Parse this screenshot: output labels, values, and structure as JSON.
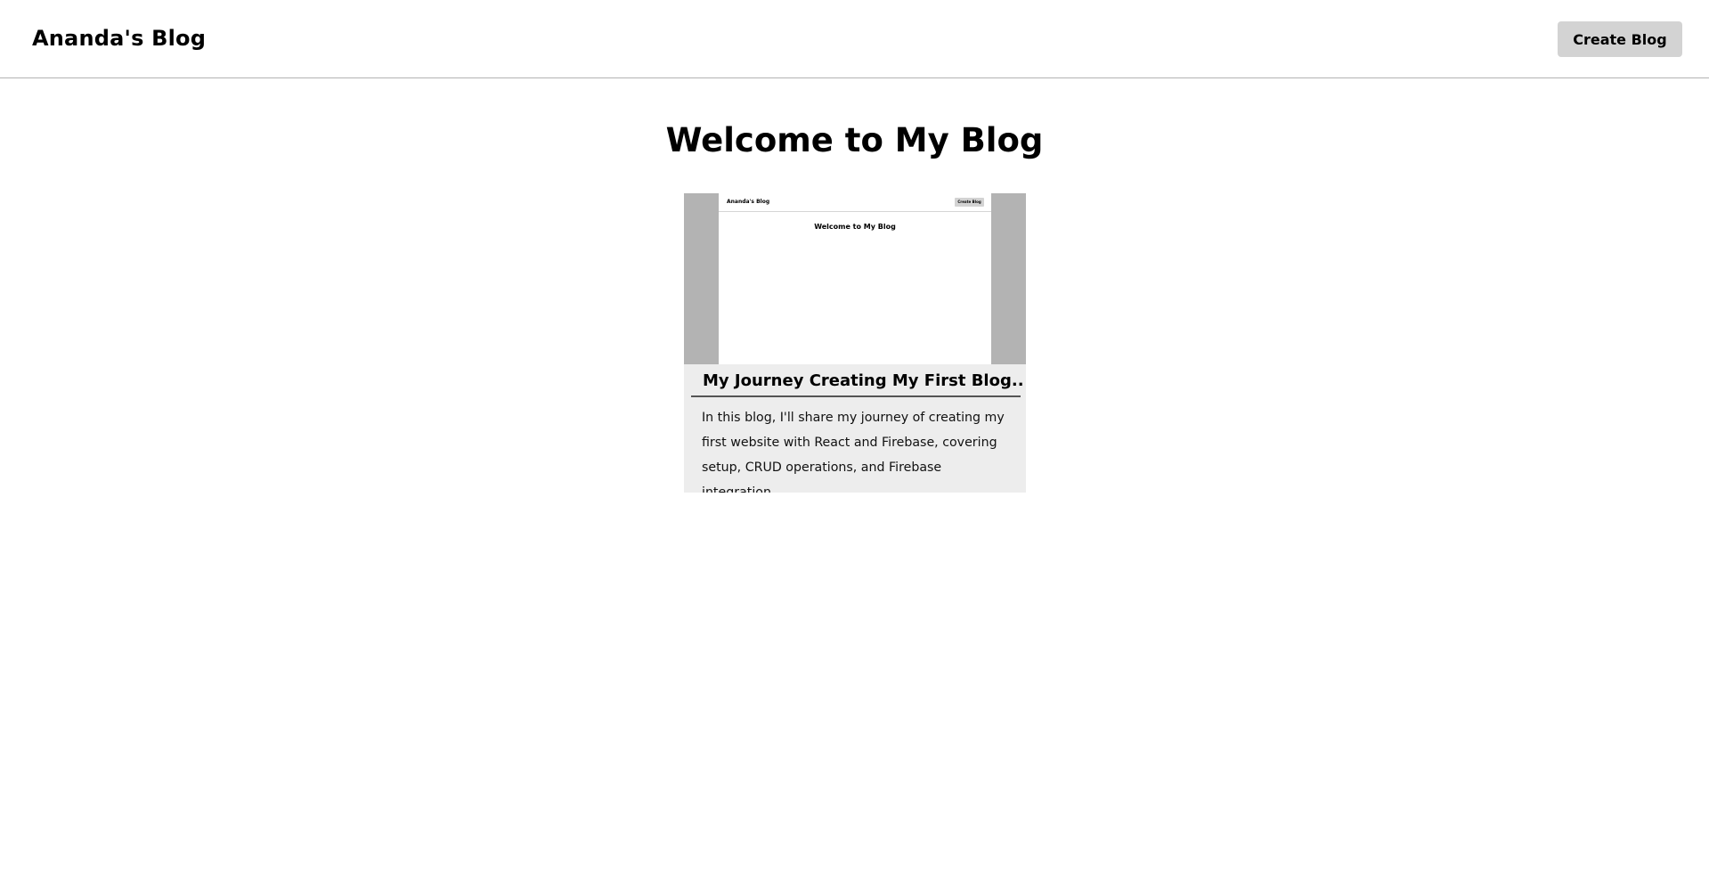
{
  "header": {
    "brand": "Ananda's Blog",
    "create_label": "Create Blog"
  },
  "main": {
    "title": "Welcome to My Blog"
  },
  "posts": [
    {
      "title": "My Journey Creating My First Blog..",
      "description": "In this blog, I'll share my journey of creating my first website with React and Firebase, covering setup, CRUD operations, and Firebase integration.",
      "thumbnail": {
        "brand": "Ananda's Blog",
        "create_label": "Create Blog",
        "title": "Welcome to My Blog"
      }
    }
  ],
  "colors": {
    "button_bg": "#d3d3d3",
    "card_bg": "#ededed",
    "thumb_frame": "#b3b3b3"
  }
}
